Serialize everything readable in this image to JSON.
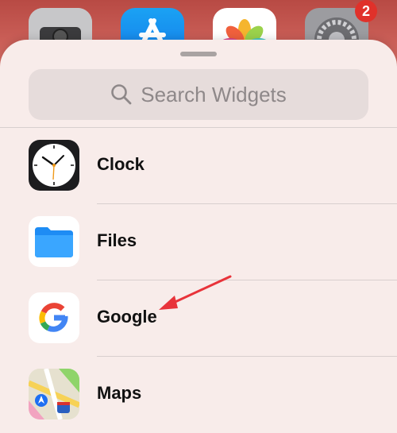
{
  "homescreen": {
    "badge_count": "2",
    "icons": [
      "camera-icon",
      "app-store-icon",
      "photos-icon",
      "settings-icon"
    ]
  },
  "search": {
    "placeholder": "Search Widgets"
  },
  "widgets": [
    {
      "label": "Clock",
      "icon": "clock-icon"
    },
    {
      "label": "Files",
      "icon": "files-icon"
    },
    {
      "label": "Google",
      "icon": "google-icon"
    },
    {
      "label": "Maps",
      "icon": "maps-icon"
    }
  ],
  "annotation": {
    "arrow_color": "#e8333a",
    "points_to": "Google"
  }
}
